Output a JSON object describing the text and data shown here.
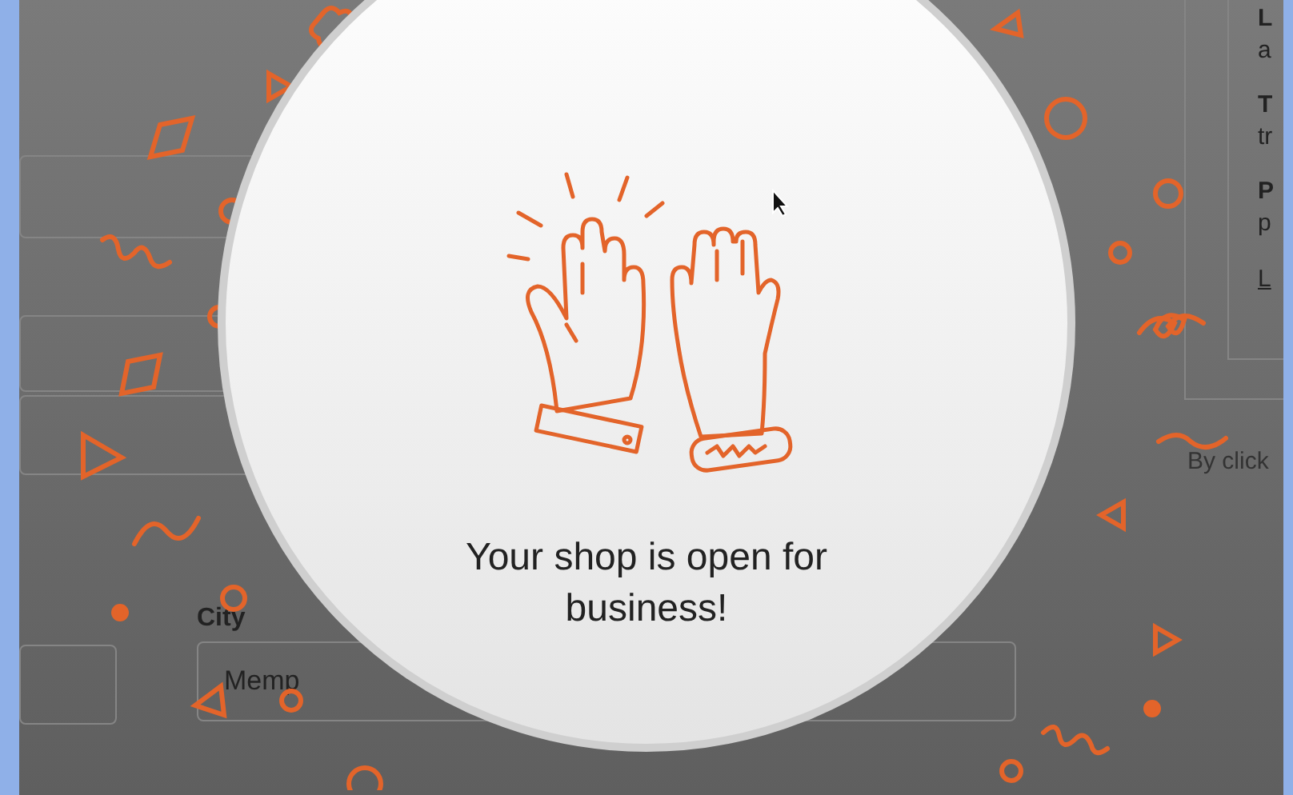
{
  "side_panel": {
    "items": [
      {
        "title": "L",
        "text": "a"
      },
      {
        "title": "T",
        "text": "tr"
      },
      {
        "title": "P",
        "text": "p"
      }
    ],
    "link": "L"
  },
  "terms_text": "By click",
  "city_field": {
    "label": "City",
    "value": "Memp"
  },
  "modal": {
    "message": "Your shop is open for business!"
  }
}
